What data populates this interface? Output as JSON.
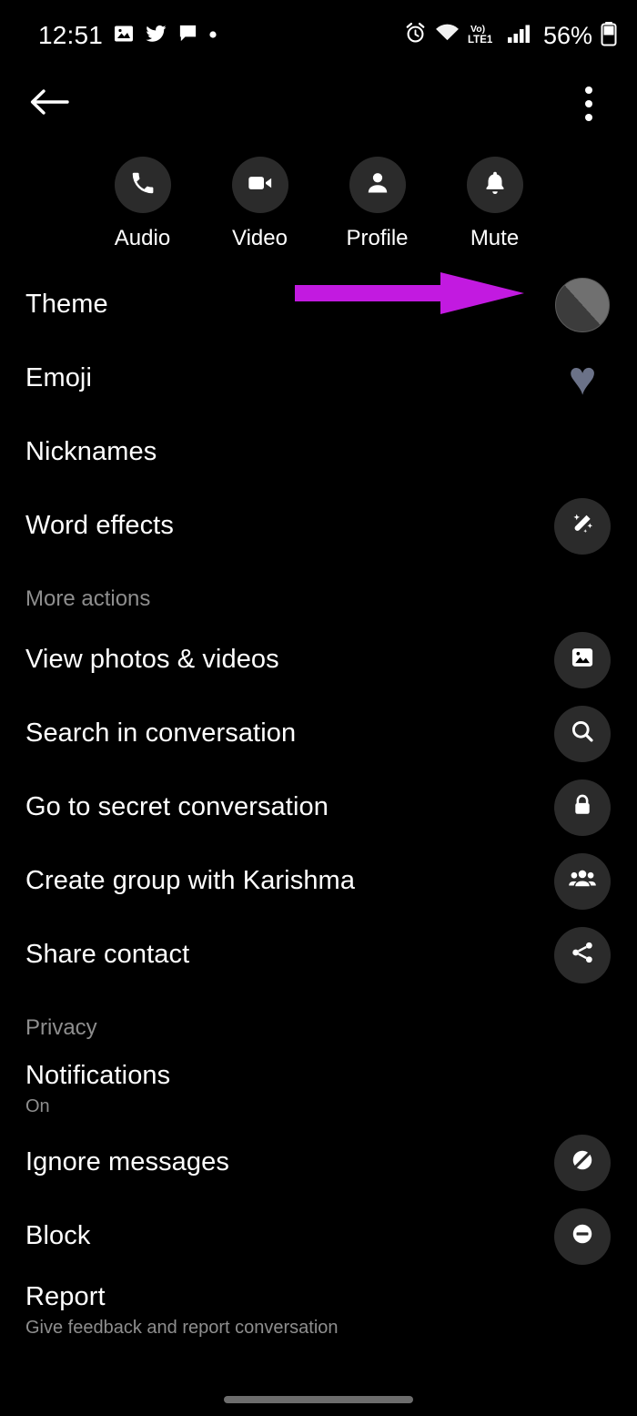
{
  "status_bar": {
    "time": "12:51",
    "battery_percent": "56%",
    "network_label": "LTE1",
    "volte_label": "Vo)",
    "left_icons": [
      "image-icon",
      "twitter-icon",
      "message-bubble-icon",
      "dot-icon"
    ],
    "right_icons": [
      "alarm-icon",
      "wifi-icon",
      "volte-icon",
      "signal-bars-icon",
      "battery-icon"
    ]
  },
  "app_bar": {
    "back_icon": "back-arrow-icon",
    "overflow_icon": "kebab-menu-icon"
  },
  "quick_actions": [
    {
      "label": "Audio",
      "icon": "phone-icon"
    },
    {
      "label": "Video",
      "icon": "video-camera-icon"
    },
    {
      "label": "Profile",
      "icon": "person-icon"
    },
    {
      "label": "Mute",
      "icon": "bell-icon"
    }
  ],
  "sections": [
    {
      "header": null,
      "rows": [
        {
          "title": "Theme",
          "subtitle": null,
          "end": "theme-swatch"
        },
        {
          "title": "Emoji",
          "subtitle": null,
          "end": "heart-emoji",
          "emoji": "♥"
        },
        {
          "title": "Nicknames",
          "subtitle": null,
          "end": null
        },
        {
          "title": "Word effects",
          "subtitle": null,
          "end": "magic-wand-icon"
        }
      ]
    },
    {
      "header": "More actions",
      "rows": [
        {
          "title": "View photos & videos",
          "subtitle": null,
          "end": "photo-icon"
        },
        {
          "title": "Search in conversation",
          "subtitle": null,
          "end": "search-icon"
        },
        {
          "title": "Go to secret conversation",
          "subtitle": null,
          "end": "lock-icon"
        },
        {
          "title": "Create group with Karishma",
          "subtitle": null,
          "end": "people-icon"
        },
        {
          "title": "Share contact",
          "subtitle": null,
          "end": "share-icon"
        }
      ]
    },
    {
      "header": "Privacy",
      "rows": [
        {
          "title": "Notifications",
          "subtitle": "On",
          "end": null
        },
        {
          "title": "Ignore messages",
          "subtitle": null,
          "end": "ignore-icon"
        },
        {
          "title": "Block",
          "subtitle": null,
          "end": "block-icon"
        },
        {
          "title": "Report",
          "subtitle": "Give feedback and report conversation",
          "end": null
        }
      ]
    }
  ],
  "annotation": {
    "type": "arrow",
    "points_to": "Theme",
    "color": "#c21ae0"
  },
  "colors": {
    "background": "#000000",
    "primary_text": "#ffffff",
    "secondary_text": "#8e8e8e",
    "icon_circle": "#2b2b2b",
    "accent_annotation": "#c21ae0"
  }
}
